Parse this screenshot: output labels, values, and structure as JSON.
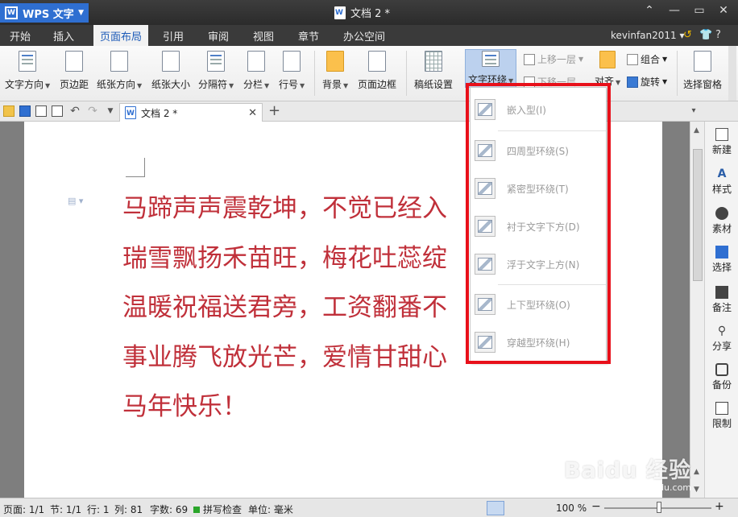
{
  "app": {
    "name": "WPS 文字",
    "logo_letter": "W",
    "document_title": "文档 2 *"
  },
  "menu_tabs": [
    "开始",
    "插入",
    "页面布局",
    "引用",
    "审阅",
    "视图",
    "章节",
    "办公空间"
  ],
  "active_tab": "页面布局",
  "user": "kevinfan2011",
  "ribbon": {
    "text_direction": "文字方向",
    "margins": "页边距",
    "orientation": "纸张方向",
    "paper_size": "纸张大小",
    "breaks": "分隔符",
    "columns": "分栏",
    "line_numbers": "行号",
    "background": "背景",
    "page_border": "页面边框",
    "manuscript": "稿纸设置",
    "text_wrap": "文字环绕",
    "bring_forward": "上移一层",
    "send_backward": "下移一层",
    "align": "对齐",
    "group": "组合",
    "rotate": "旋转",
    "selection_pane": "选择窗格"
  },
  "doc_tab": {
    "label": "文档 2 *"
  },
  "document": {
    "lines": [
      "马蹄声声震乾坤，不觉已经入",
      "瑞雪飘扬禾苗旺，梅花吐蕊绽",
      "温暖祝福送君旁，工资翻番不",
      "事业腾飞放光芒，爱情甘甜心",
      "马年快乐！"
    ]
  },
  "wrap_menu": {
    "items": [
      "嵌入型(I)",
      "四周型环绕(S)",
      "紧密型环绕(T)",
      "衬于文字下方(D)",
      "浮于文字上方(N)",
      "上下型环绕(O)",
      "穿越型环绕(H)"
    ]
  },
  "side_panel": [
    "新建",
    "样式",
    "素材",
    "选择",
    "备注",
    "分享",
    "备份",
    "限制"
  ],
  "status": {
    "page": "页面: 1/1",
    "section": "节: 1/1",
    "row": "行: 1",
    "column": "列: 81",
    "word_count": "字数: 69",
    "spell_check": "拼写检查",
    "unit": "单位: 毫米",
    "zoom": "100 %"
  },
  "watermark": {
    "brand": "Baidu 经验",
    "url": "jingyan.baidu.com"
  },
  "colors": {
    "accent": "#2f6fd1",
    "poem_text": "#c0303a",
    "highlight": "#e8101a"
  }
}
